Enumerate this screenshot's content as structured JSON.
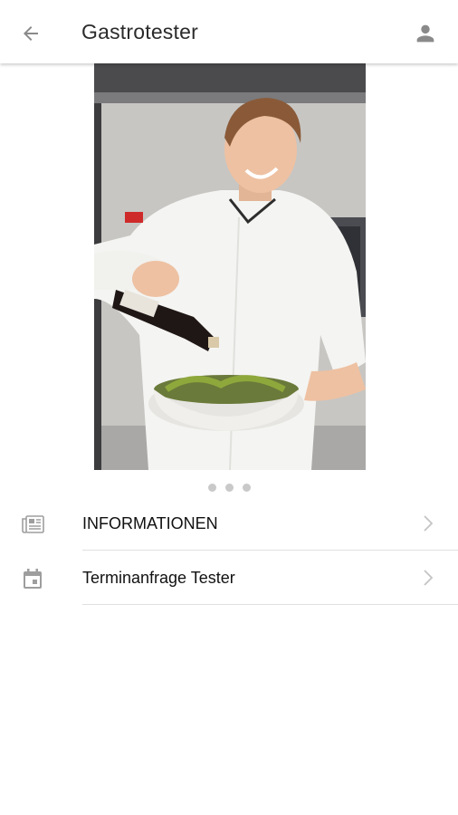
{
  "appbar": {
    "title": "Gastrotester",
    "back_icon": "arrow-left-icon",
    "profile_icon": "person-icon"
  },
  "carousel": {
    "image_description_icon": "chef-photo",
    "page_count": 3,
    "active_index": 0
  },
  "menu": {
    "items": [
      {
        "label": "INFORMATIONEN",
        "icon": "newspaper-icon"
      },
      {
        "label": "Terminanfrage Tester",
        "icon": "calendar-icon"
      }
    ]
  },
  "colors": {
    "icon_gray": "#9e9e9e",
    "title_text": "#2b2b2b",
    "divider": "#e0e0e0",
    "dot": "#c9c9c9"
  }
}
